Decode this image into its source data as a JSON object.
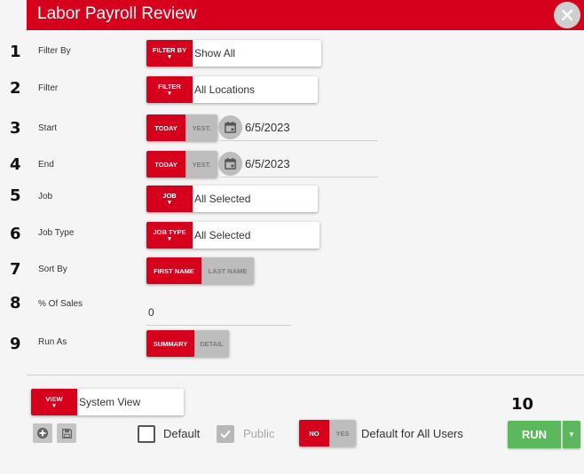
{
  "title": "Labor Payroll Review",
  "icons": {
    "close": "close-icon",
    "calendar": "calendar-icon",
    "add": "add-circle-icon",
    "save": "save-icon",
    "check": "check-icon",
    "caret": "caret-down-icon"
  },
  "colors": {
    "accent": "#d6001c",
    "run": "#5cb85c",
    "toggle_off": "#bdbdbd"
  },
  "steps": [
    "1",
    "2",
    "3",
    "4",
    "5",
    "6",
    "7",
    "8",
    "9",
    "10"
  ],
  "fields": {
    "filter_by": {
      "label": "Filter By",
      "tag": "FILTER BY",
      "value": "Show All"
    },
    "filter": {
      "label": "Filter",
      "tag": "FILTER",
      "value": "All Locations"
    },
    "start": {
      "label": "Start",
      "today": "TODAY",
      "yest": "YEST.",
      "date": "6/5/2023"
    },
    "end": {
      "label": "End",
      "today": "TODAY",
      "yest": "YEST.",
      "date": "6/5/2023"
    },
    "job": {
      "label": "Job",
      "tag": "JOB",
      "value": "All Selected"
    },
    "job_type": {
      "label": "Job Type",
      "tag": "JOB TYPE",
      "value": "All Selected"
    },
    "sort_by": {
      "label": "Sort By",
      "option_on": "FIRST NAME",
      "option_off": "LAST NAME"
    },
    "pct_sales": {
      "label": "% Of Sales",
      "value": "0"
    },
    "run_as": {
      "label": "Run As",
      "option_on": "SUMMARY",
      "option_off": "DETAIL"
    }
  },
  "footer": {
    "view_tag": "VIEW",
    "view_value": "System View",
    "default_label": "Default",
    "default_checked": false,
    "public_label": "Public",
    "public_checked": true,
    "no_label": "NO",
    "yes_label": "YES",
    "default_all_label": "Default for All Users",
    "run_label": "RUN"
  }
}
